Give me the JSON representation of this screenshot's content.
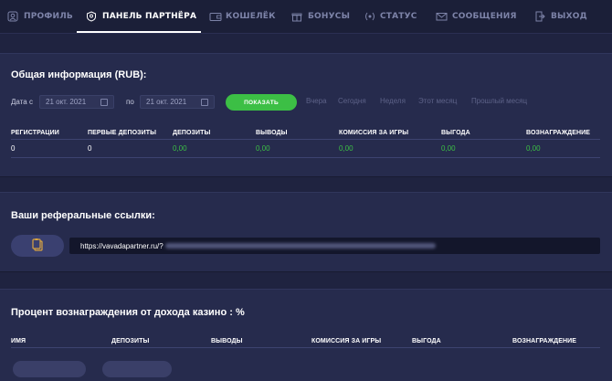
{
  "nav": {
    "items": [
      {
        "label": "ПРОФИЛЬ",
        "icon": "user-icon"
      },
      {
        "label": "ПАНЕЛЬ ПАРТНЁРА",
        "icon": "partner-badge-icon",
        "active": true
      },
      {
        "label": "КОШЕЛЁК",
        "icon": "wallet-icon"
      },
      {
        "label": "БОНУСЫ",
        "icon": "gift-icon"
      },
      {
        "label": "СТАТУС",
        "icon": "laurel-icon"
      },
      {
        "label": "СООБЩЕНИЯ",
        "icon": "envelope-icon"
      },
      {
        "label": "ВЫХОД",
        "icon": "exit-icon"
      }
    ]
  },
  "general": {
    "title": "Общая информация (RUB):",
    "date_from_label": "Дата с",
    "date_from": "21 окт.  2021",
    "date_to_label": "по",
    "date_to": "21 окт.  2021",
    "show_button": "ПОКАЗАТЬ",
    "quick_ranges": [
      "Вчера",
      "Сегодня",
      "Неделя",
      "Этот месяц",
      "Прошлый месяц"
    ],
    "columns": [
      "РЕГИСТРАЦИИ",
      "ПЕРВЫЕ ДЕПОЗИТЫ",
      "ДЕПОЗИТЫ",
      "ВЫВОДЫ",
      "КОМИССИЯ ЗА ИГРЫ",
      "ВЫГОДА",
      "ВОЗНАГРАЖДЕНИЕ"
    ],
    "values": [
      "0",
      "0",
      "0,00",
      "0,00",
      "0,00",
      "0,00",
      "0,00"
    ],
    "value_color": "#3cbf45"
  },
  "referral": {
    "title": "Ваши реферальные ссылки:",
    "link_prefix": "https://vavadapartner.ru/?"
  },
  "commission": {
    "title": "Процент вознаграждения от дохода казино : %",
    "columns": [
      "ИМЯ",
      "ДЕПОЗИТЫ",
      "ВЫВОДЫ",
      "КОМИССИЯ ЗА ИГРЫ",
      "ВЫГОДА",
      "ВОЗНАГРАЖДЕНИЕ"
    ]
  },
  "colors": {
    "background": "#1f2340",
    "panel": "#262b4d",
    "accent_green": "#3cbf45",
    "muted_text": "#7d83a8"
  }
}
